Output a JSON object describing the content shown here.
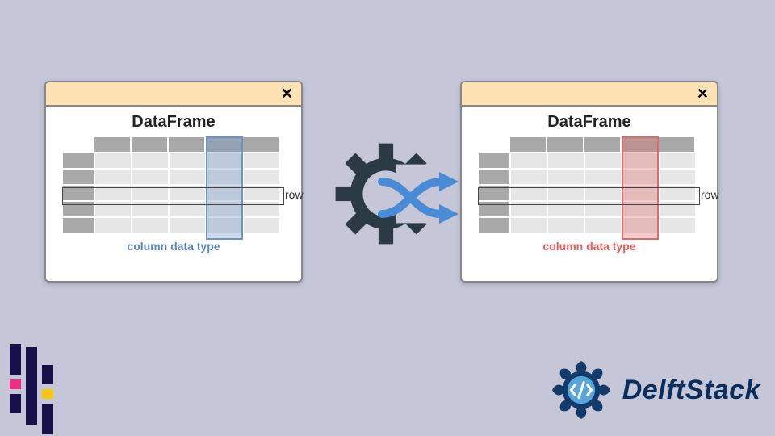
{
  "panel": {
    "close_label": "✕",
    "title": "DataFrame",
    "row_label": "row",
    "col_label": "column data type"
  },
  "highlight": {
    "left_color": "blue",
    "right_color": "red"
  },
  "brand": {
    "name": "DelftStack"
  },
  "chart_data": {
    "type": "table",
    "description": "Generic DataFrame grid icon: 5 unnamed columns × 5 unnamed rows, grey cells with darker header/index. One row and one column are highlighted. Left panel highlight = blue (original dtype), right panel highlight = red (changed dtype).",
    "columns": 5,
    "rows": 5,
    "highlighted_column_index": 3,
    "highlighted_row_index": 2
  }
}
